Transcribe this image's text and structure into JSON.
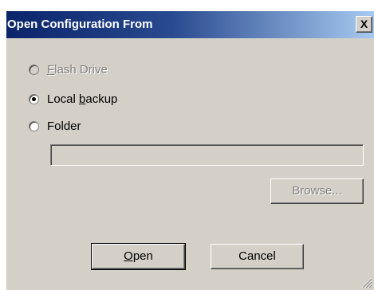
{
  "dialog": {
    "title": "Open Configuration From",
    "close_label": "X"
  },
  "options": [
    {
      "label": "Flash Drive",
      "accel": "F",
      "rest": "lash Drive",
      "checked": false,
      "disabled": true
    },
    {
      "label": "Local backup",
      "pre": "Local ",
      "accel": "b",
      "rest": "ackup",
      "checked": true,
      "disabled": false
    },
    {
      "label": "Folder",
      "checked": false,
      "disabled": false
    }
  ],
  "folder_path": {
    "value": ""
  },
  "buttons": {
    "browse": "Browse...",
    "open": {
      "label": "Open",
      "accel": "O",
      "rest": "pen"
    },
    "cancel": "Cancel"
  }
}
